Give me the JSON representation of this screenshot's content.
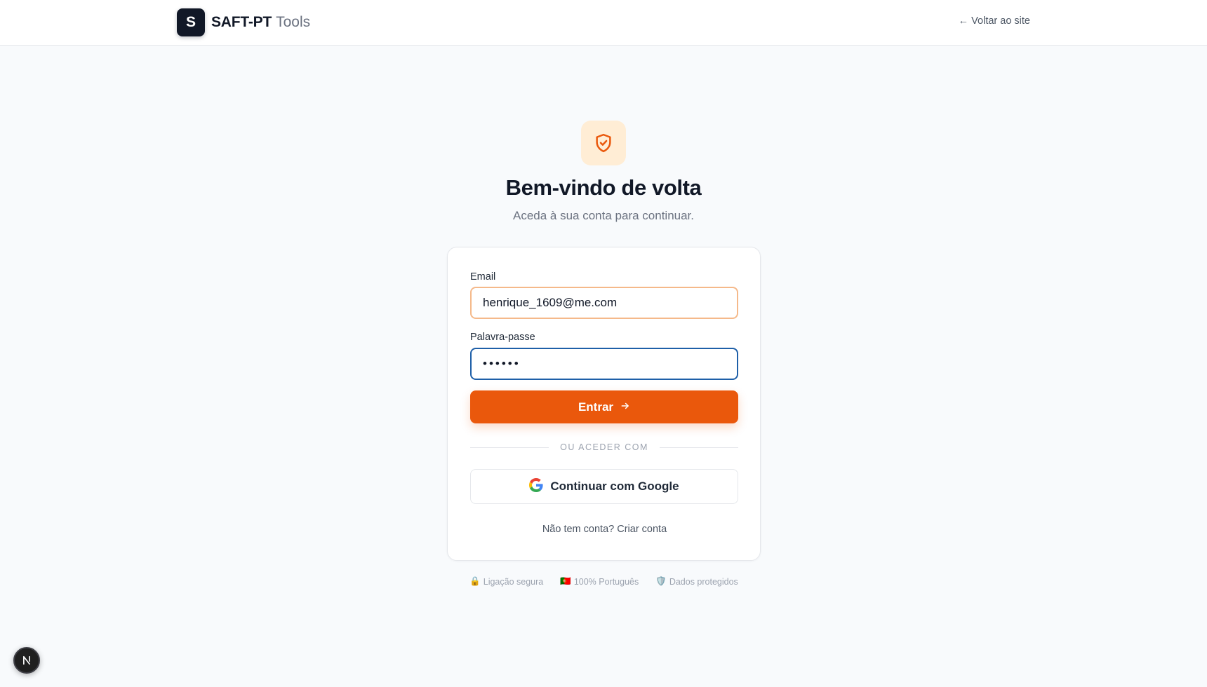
{
  "header": {
    "logo_letter": "S",
    "brand_name": "SAFT-PT",
    "brand_suffix": "Tools",
    "back_link": "← Voltar ao site"
  },
  "hero": {
    "icon": "shield-check-icon",
    "title": "Bem-vindo de volta",
    "subtitle": "Aceda à sua conta para continuar."
  },
  "form": {
    "email_label": "Email",
    "email_value": "henrique_1609@me.com",
    "password_label": "Palavra-passe",
    "password_value": "••••••",
    "submit_label": "Entrar",
    "divider_text": "OU ACEDER COM",
    "google_label": "Continuar com Google",
    "signup_prompt": "Não tem conta?",
    "signup_link": "Criar conta"
  },
  "trust": [
    {
      "icon": "🔒",
      "label": "Ligação segura"
    },
    {
      "icon": "🇵🇹",
      "label": "100% Português"
    },
    {
      "icon": "🛡️",
      "label": "Dados protegidos"
    }
  ],
  "dev_badge": {
    "letter": "N"
  },
  "colors": {
    "accent": "#ea580c",
    "accent_soft": "#ffedd5",
    "brand_dark": "#111827",
    "focus_blue": "#1e5fa8",
    "page_bg": "#f8fafc"
  }
}
